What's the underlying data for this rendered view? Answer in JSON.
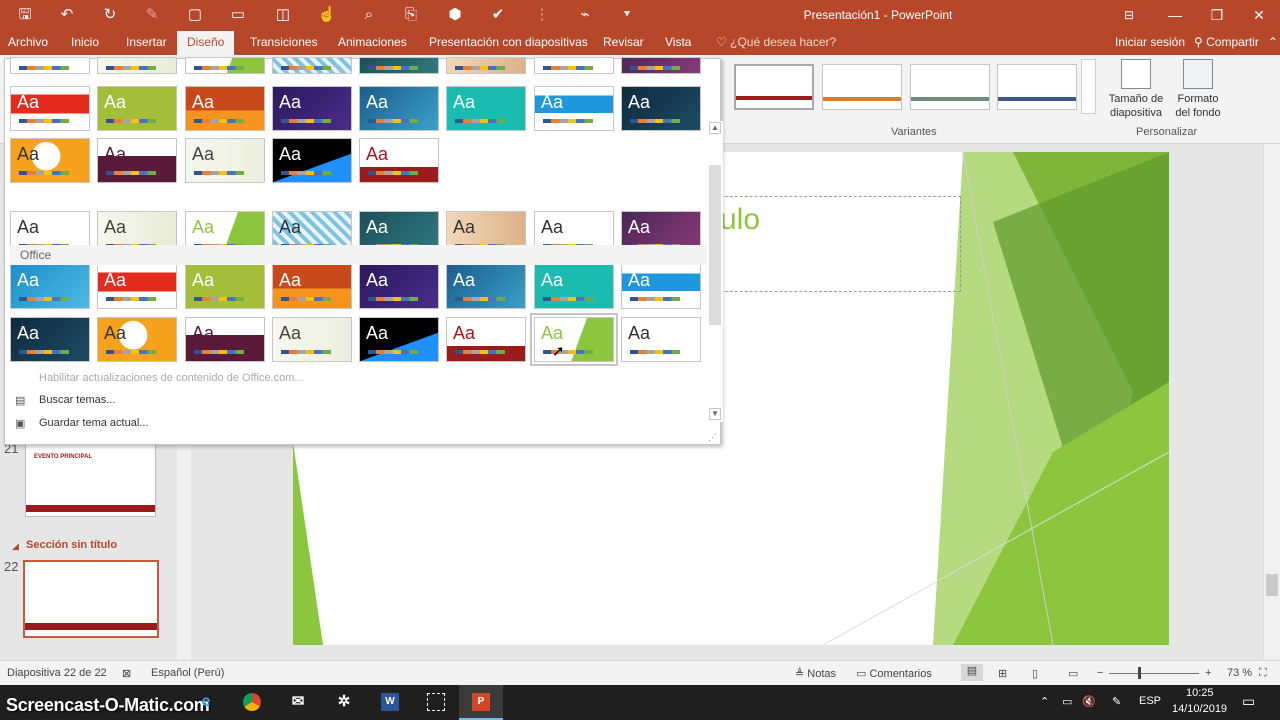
{
  "window": {
    "title": "Presentación1 - PowerPoint"
  },
  "tabs": [
    {
      "label": "Archivo"
    },
    {
      "label": "Inicio"
    },
    {
      "label": "Insertar"
    },
    {
      "label": "Diseño"
    },
    {
      "label": "Transiciones"
    },
    {
      "label": "Animaciones"
    },
    {
      "label": "Presentación con diapositivas"
    },
    {
      "label": "Revisar"
    },
    {
      "label": "Vista"
    }
  ],
  "active_tab": "Diseño",
  "tell_me": {
    "label": "¿Qué desea hacer?"
  },
  "account": {
    "signin_label": "Iniciar sesión",
    "share_label": "Compartir"
  },
  "ribbon": {
    "variants_label": "Variantes",
    "customize_label": "Personalizar",
    "slide_size_label": "Tamaño de diapositiva",
    "format_bg_label": "Formato del fondo"
  },
  "theme_gallery": {
    "section_office": "Office",
    "theme_glyph": "Aa",
    "menu": {
      "enable_updates": "Habilitar actualizaciones de contenido de Office.com...",
      "browse_themes": "Buscar temas...",
      "save_theme": "Guardar tema actual..."
    }
  },
  "slide": {
    "title_fragment": "ulo"
  },
  "thumbnails": {
    "slide21_num": "21",
    "slide21_text": "EVENTO PRINCIPAL",
    "section_label": "Sección sin título",
    "slide22_num": "22"
  },
  "status": {
    "slide_counter": "Diapositiva 22 de 22",
    "language": "Español (Perú)",
    "notes_label": "Notas",
    "comments_label": "Comentarios",
    "zoom": "73 %"
  },
  "taskbar": {
    "watermark": "Screencast-O-Matic.com",
    "lang": "ESP",
    "time": "10:25",
    "date": "14/10/2019"
  },
  "colors": {
    "accent": "#b7472a",
    "slide_green": "#8cc63f"
  }
}
